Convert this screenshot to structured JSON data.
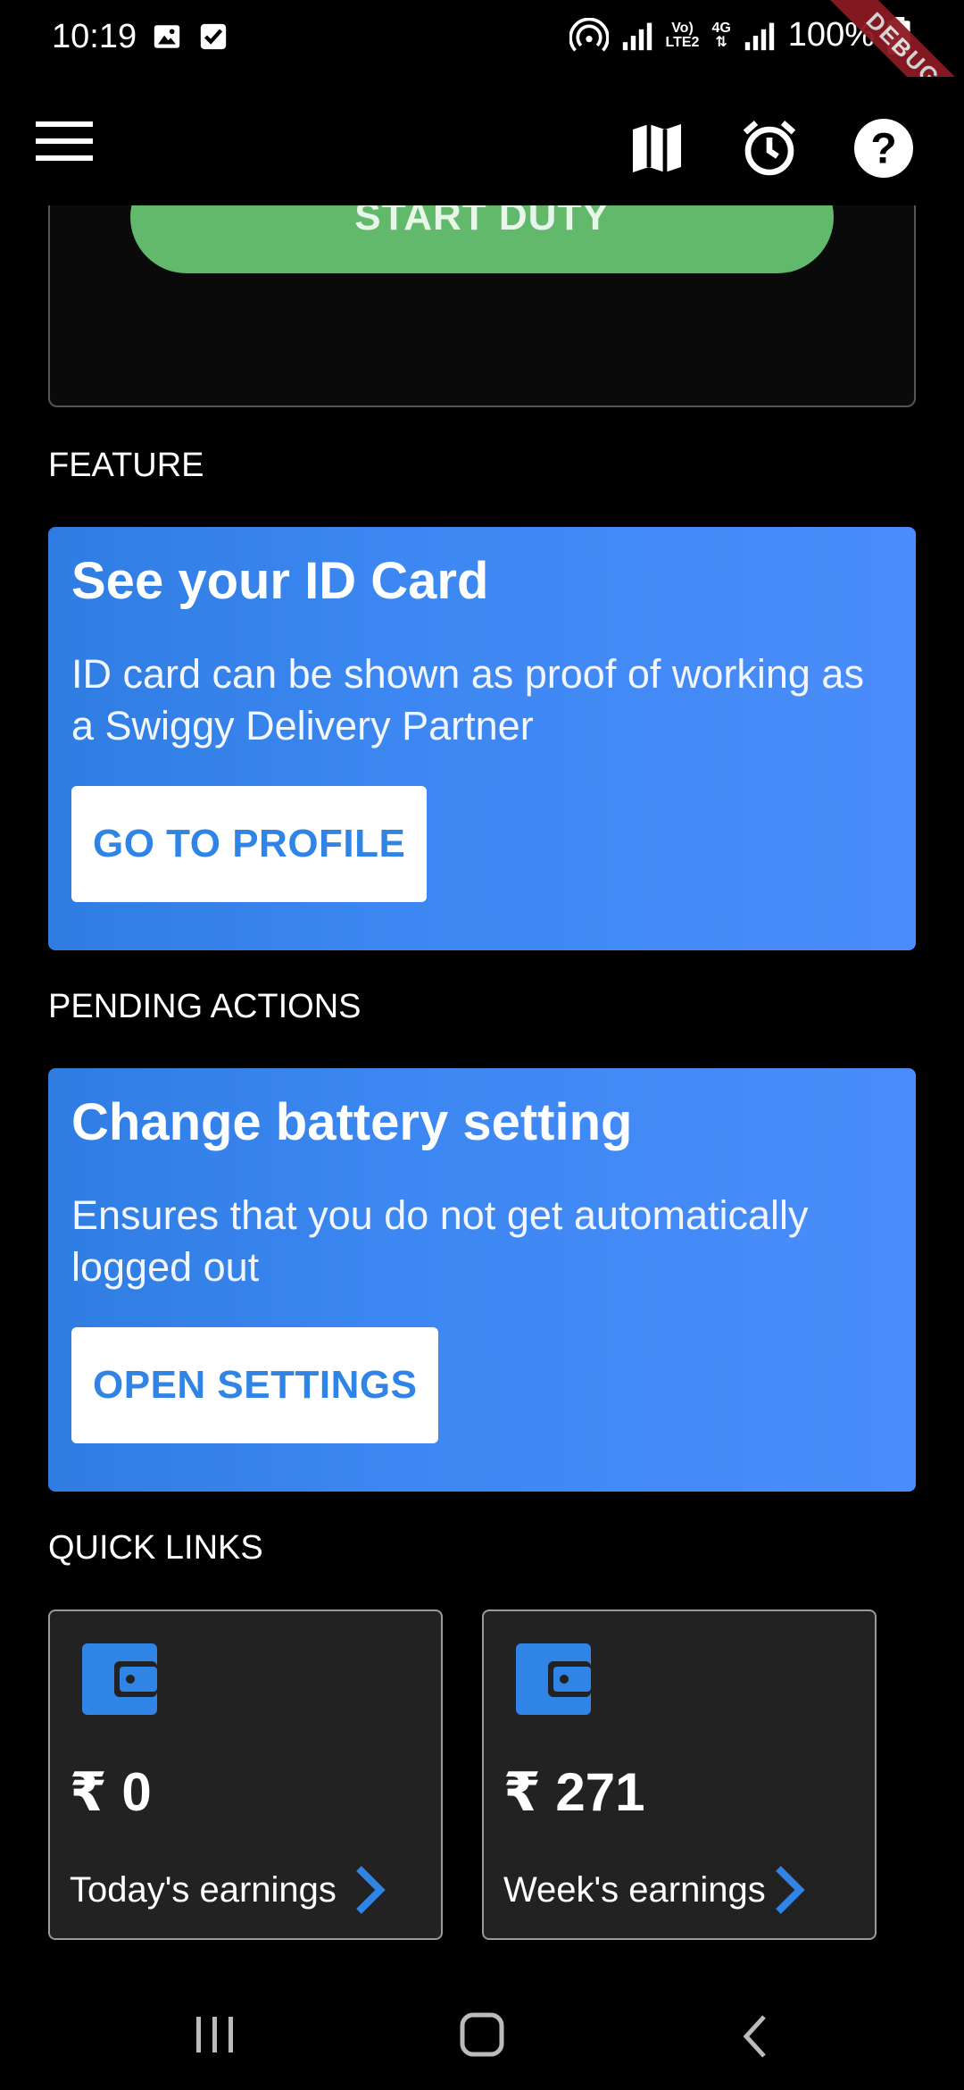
{
  "status_bar": {
    "time": "10:19",
    "network_label_top": "Vo)",
    "network_label_bottom": "LTE2",
    "network_type": "4G",
    "battery": "100%",
    "debug_banner": "DEBUG"
  },
  "app_bar": {
    "icons": [
      "menu-icon",
      "map-icon",
      "alarm-icon",
      "help-icon"
    ]
  },
  "duty": {
    "button_label": "START DUTY"
  },
  "feature": {
    "section_title": "FEATURE",
    "card_title": "See your ID Card",
    "card_desc": "ID card can be shown as proof of working as a Swiggy Delivery Partner",
    "button_label": "GO TO PROFILE"
  },
  "pending": {
    "section_title": "PENDING ACTIONS",
    "card_title": "Change battery setting",
    "card_desc": "Ensures that you do not get automatically logged out",
    "button_label": "OPEN SETTINGS"
  },
  "quick_links": {
    "section_title": "QUICK LINKS",
    "items": [
      {
        "amount": "₹ 0",
        "label": "Today's earnings"
      },
      {
        "amount": "₹ 271",
        "label": "Week's earnings"
      }
    ]
  },
  "colors": {
    "accent_blue": "#4a8dfa",
    "start_green": "#63b96b",
    "link_blue": "#2f84e6"
  }
}
